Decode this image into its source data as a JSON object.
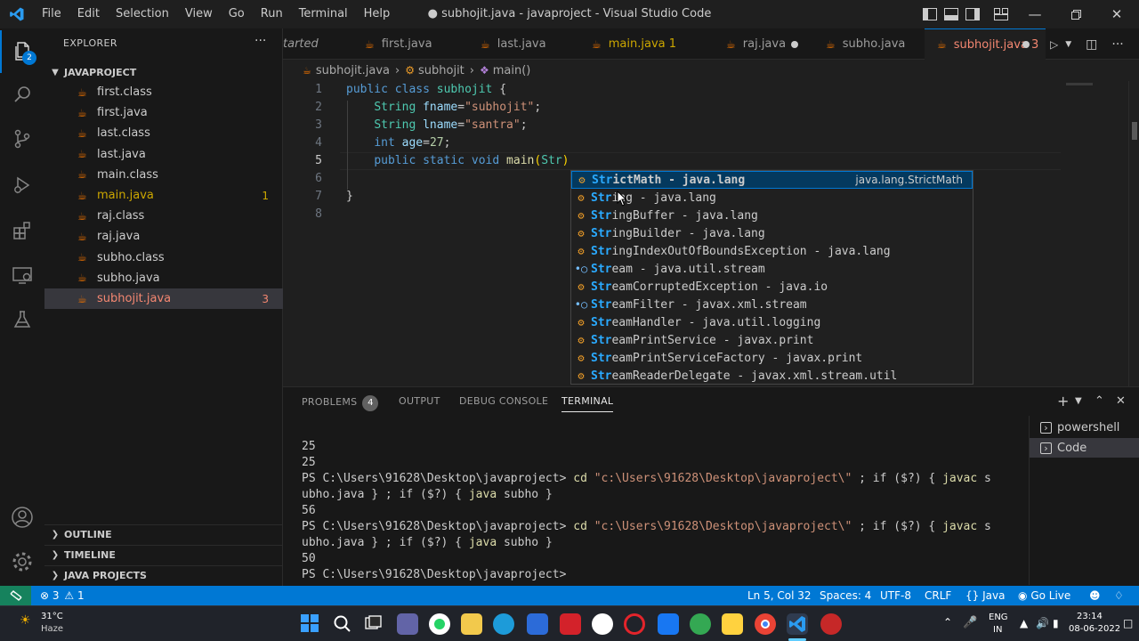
{
  "window": {
    "title": "● subhojit.java - javaproject - Visual Studio Code",
    "menu": [
      "File",
      "Edit",
      "Selection",
      "View",
      "Go",
      "Run",
      "Terminal",
      "Help"
    ]
  },
  "activity_bar": {
    "explorer_badge": "2",
    "items": [
      "explorer-icon",
      "search-icon",
      "source-control-icon",
      "run-debug-icon",
      "extensions-icon",
      "remote-explorer-icon",
      "testing-icon",
      "accounts-icon",
      "settings-gear-icon"
    ]
  },
  "sidebar": {
    "title": "EXPLORER",
    "more": "···",
    "project": "JAVAPROJECT",
    "files": [
      {
        "name": "first.class",
        "count": "",
        "state": "normal"
      },
      {
        "name": "first.java",
        "count": "",
        "state": "normal"
      },
      {
        "name": "last.class",
        "count": "",
        "state": "normal"
      },
      {
        "name": "last.java",
        "count": "",
        "state": "normal"
      },
      {
        "name": "main.class",
        "count": "",
        "state": "normal"
      },
      {
        "name": "main.java",
        "count": "1",
        "state": "warn"
      },
      {
        "name": "raj.class",
        "count": "",
        "state": "normal"
      },
      {
        "name": "raj.java",
        "count": "",
        "state": "normal"
      },
      {
        "name": "subho.class",
        "count": "",
        "state": "normal"
      },
      {
        "name": "subho.java",
        "count": "",
        "state": "normal"
      },
      {
        "name": "subhojit.java",
        "count": "3",
        "state": "err"
      }
    ],
    "sections": [
      "OUTLINE",
      "TIMELINE",
      "JAVA PROJECTS"
    ]
  },
  "tabs": [
    {
      "label": "tarted",
      "extra": "",
      "state": "normal"
    },
    {
      "label": "first.java",
      "extra": "",
      "state": "normal"
    },
    {
      "label": "last.java",
      "extra": "",
      "state": "normal"
    },
    {
      "label": "main.java 1",
      "extra": "",
      "state": "warn"
    },
    {
      "label": "raj.java",
      "extra": "dot",
      "state": "normal"
    },
    {
      "label": "subho.java",
      "extra": "",
      "state": "normal"
    },
    {
      "label": "subhojit.java 3",
      "extra": "dot",
      "state": "active"
    }
  ],
  "breadcrumb": {
    "file": "subhojit.java",
    "cls": "subhojit",
    "method": "main()"
  },
  "editor": {
    "current_line": 5,
    "lines": [
      {
        "n": "1",
        "tokens": [
          [
            "kw",
            "public "
          ],
          [
            "kw",
            "class "
          ],
          [
            "ty",
            "subhojit "
          ],
          [
            "p",
            "{"
          ]
        ]
      },
      {
        "n": "2",
        "tokens": [
          [
            "p",
            "    "
          ],
          [
            "ty",
            "String "
          ],
          [
            "va",
            "fname"
          ],
          [
            "p",
            "="
          ],
          [
            "st",
            "\"subhojit\""
          ],
          [
            "p",
            ";"
          ]
        ]
      },
      {
        "n": "3",
        "tokens": [
          [
            "p",
            "    "
          ],
          [
            "ty",
            "String "
          ],
          [
            "va",
            "lname"
          ],
          [
            "p",
            "="
          ],
          [
            "st",
            "\"santra\""
          ],
          [
            "p",
            ";"
          ]
        ]
      },
      {
        "n": "4",
        "tokens": [
          [
            "p",
            "    "
          ],
          [
            "kw",
            "int "
          ],
          [
            "va",
            "age"
          ],
          [
            "p",
            "="
          ],
          [
            "nu",
            "27"
          ],
          [
            "p",
            ";"
          ]
        ]
      },
      {
        "n": "5",
        "tokens": [
          [
            "p",
            "    "
          ],
          [
            "kw",
            "public "
          ],
          [
            "kw",
            "static "
          ],
          [
            "kw",
            "void "
          ],
          [
            "fn",
            "main"
          ],
          [
            "br",
            "("
          ],
          [
            "ty",
            "Str"
          ],
          [
            "br",
            ")"
          ]
        ]
      },
      {
        "n": "6",
        "tokens": [
          [
            "p",
            ""
          ]
        ]
      },
      {
        "n": "7",
        "tokens": [
          [
            "p",
            "}"
          ]
        ]
      },
      {
        "n": "8",
        "tokens": [
          [
            "p",
            ""
          ]
        ]
      }
    ]
  },
  "suggestions": {
    "focused_detail": "java.lang.StrictMath",
    "items": [
      {
        "match": "Str",
        "rest": "ictMath - java.lang",
        "kind": "class"
      },
      {
        "match": "Str",
        "rest": "ing - java.lang",
        "kind": "class"
      },
      {
        "match": "Str",
        "rest": "ingBuffer - java.lang",
        "kind": "class"
      },
      {
        "match": "Str",
        "rest": "ingBuilder - java.lang",
        "kind": "class"
      },
      {
        "match": "Str",
        "rest": "ingIndexOutOfBoundsException - java.lang",
        "kind": "class"
      },
      {
        "match": "Str",
        "rest": "eam - java.util.stream",
        "kind": "module"
      },
      {
        "match": "Str",
        "rest": "eamCorruptedException - java.io",
        "kind": "class"
      },
      {
        "match": "Str",
        "rest": "eamFilter - javax.xml.stream",
        "kind": "module"
      },
      {
        "match": "Str",
        "rest": "eamHandler - java.util.logging",
        "kind": "class"
      },
      {
        "match": "Str",
        "rest": "eamPrintService - javax.print",
        "kind": "class"
      },
      {
        "match": "Str",
        "rest": "eamPrintServiceFactory - javax.print",
        "kind": "class"
      },
      {
        "match": "Str",
        "rest": "eamReaderDelegate - javax.xml.stream.util",
        "kind": "class"
      }
    ]
  },
  "panel": {
    "tabs": [
      {
        "label": "PROBLEMS",
        "badge": "4"
      },
      {
        "label": "OUTPUT",
        "badge": ""
      },
      {
        "label": "DEBUG CONSOLE",
        "badge": ""
      },
      {
        "label": "TERMINAL",
        "badge": ""
      }
    ],
    "active_tab": "TERMINAL",
    "terminals": [
      "powershell",
      "Code"
    ],
    "terminal_lines": [
      [
        [
          "t-sp",
          "25"
        ]
      ],
      [
        [
          "t-sp",
          "25"
        ]
      ],
      [
        [
          "t-sp",
          "PS C:\\Users\\91628\\Desktop\\javaproject> "
        ],
        [
          "t-cmd",
          "cd "
        ],
        [
          "t-str",
          "\"c:\\Users\\91628\\Desktop\\javaproject\\\""
        ],
        [
          "t-sp",
          " ; if ($?) { "
        ],
        [
          "t-cmd",
          "javac"
        ],
        [
          "t-sp",
          " s"
        ]
      ],
      [
        [
          "t-sp",
          "ubho.java } ; if ($?) { "
        ],
        [
          "t-cmd",
          "java"
        ],
        [
          "t-sp",
          " subho }"
        ]
      ],
      [
        [
          "t-sp",
          "56"
        ]
      ],
      [
        [
          "t-sp",
          "PS C:\\Users\\91628\\Desktop\\javaproject> "
        ],
        [
          "t-cmd",
          "cd "
        ],
        [
          "t-str",
          "\"c:\\Users\\91628\\Desktop\\javaproject\\\""
        ],
        [
          "t-sp",
          " ; if ($?) { "
        ],
        [
          "t-cmd",
          "javac"
        ],
        [
          "t-sp",
          " s"
        ]
      ],
      [
        [
          "t-sp",
          "ubho.java } ; if ($?) { "
        ],
        [
          "t-cmd",
          "java"
        ],
        [
          "t-sp",
          " subho }"
        ]
      ],
      [
        [
          "t-sp",
          "50"
        ]
      ],
      [
        [
          "t-sp",
          "PS C:\\Users\\91628\\Desktop\\javaproject> "
        ]
      ]
    ]
  },
  "statusbar": {
    "errors": "3",
    "warnings": "1",
    "position": "Ln 5, Col 32",
    "spaces": "Spaces: 4",
    "encoding": "UTF-8",
    "eol": "CRLF",
    "language": "Java",
    "golive": "Go Live"
  },
  "taskbar": {
    "weather_temp": "31°C",
    "weather_desc": "Haze",
    "lang_top": "ENG",
    "lang_bottom": "IN",
    "time": "23:14",
    "date": "08-06-2022"
  },
  "colors": {
    "accent": "#0078d4",
    "error": "#f48771",
    "warning": "#cca700",
    "java": "#e76f00"
  }
}
